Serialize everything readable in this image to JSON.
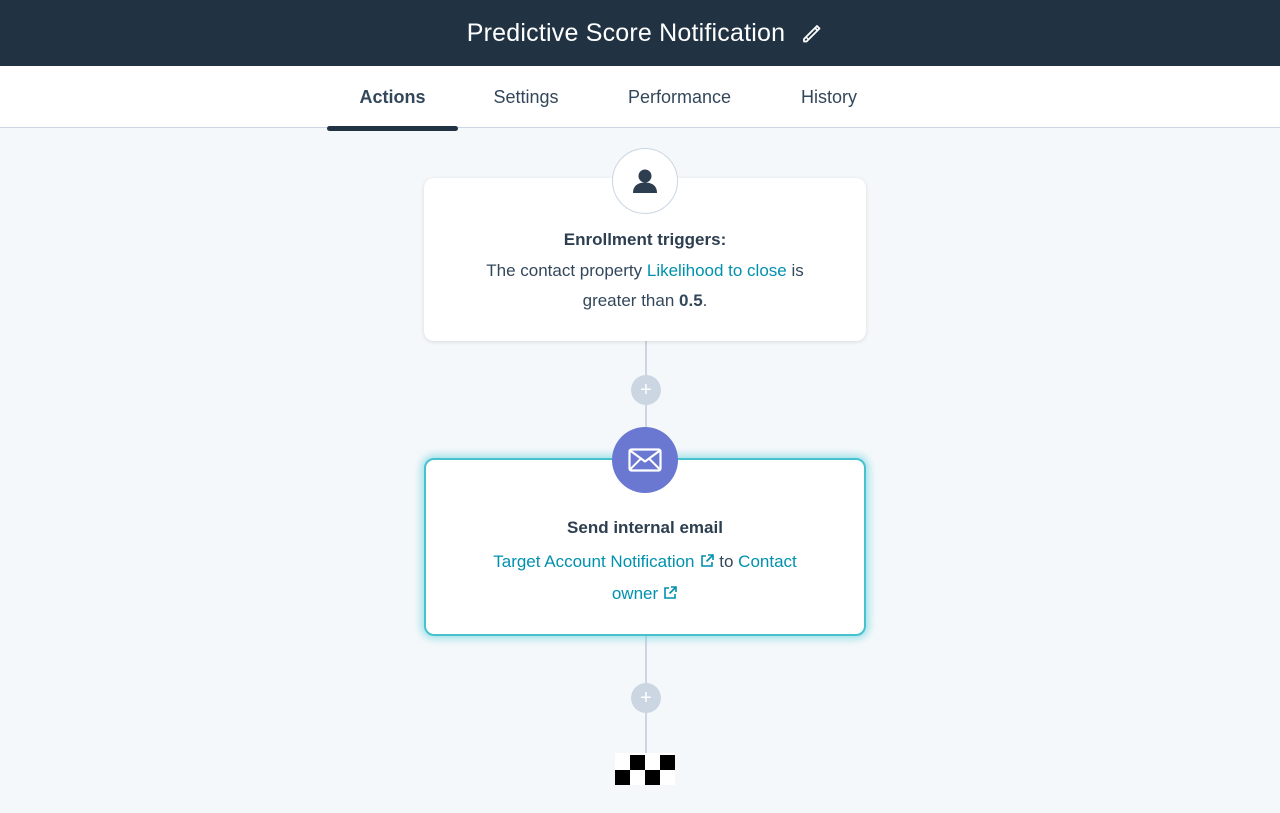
{
  "header": {
    "title": "Predictive Score Notification",
    "edit_icon": "pencil-icon"
  },
  "tabs": [
    {
      "label": "Actions",
      "active": true
    },
    {
      "label": "Settings",
      "active": false
    },
    {
      "label": "Performance",
      "active": false
    },
    {
      "label": "History",
      "active": false
    }
  ],
  "trigger_card": {
    "icon": "contact-person-icon",
    "heading": "Enrollment triggers:",
    "text_before": "The contact property ",
    "property_link": "Likelihood to close",
    "text_middle": " is greater than ",
    "value": "0.5",
    "text_after": "."
  },
  "action_card": {
    "icon": "envelope-icon",
    "heading": "Send internal email",
    "email_link": "Target Account Notification",
    "text_middle": "to",
    "recipient_link": "Contact owner"
  },
  "plus_label": "+",
  "end_icon": "checkered-flag-icon",
  "colors": {
    "header_bg": "#213343",
    "link": "#0091ae",
    "email_node": "#6a78d1",
    "selected_glow": "#48c1cf",
    "connector": "#cbd6e2"
  }
}
